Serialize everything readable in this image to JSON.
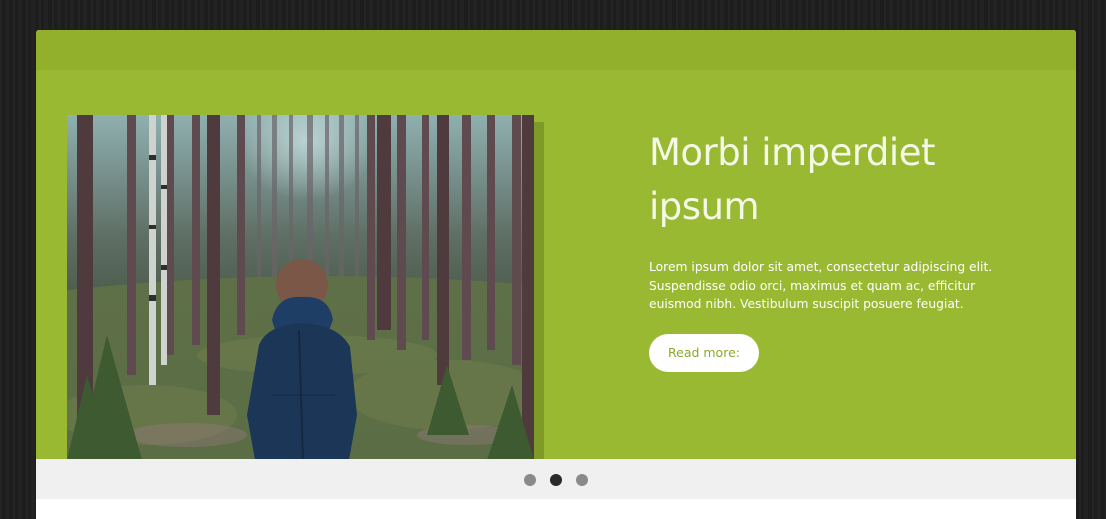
{
  "slider": {
    "title": "Morbi imperdiet ipsum",
    "text": "Lorem ipsum dolor sit amet, consectetur adipiscing elit. Suspendisse odio orci, maximus et quam ac, efficitur euismod nibh. Vestibulum suscipit posuere feugiat.",
    "button_label": "Read more:",
    "image_subject": "Person in a dark blue hooded coat standing in a pine forest, seen from behind",
    "pagination": {
      "count": 3,
      "active_index": 1
    }
  },
  "colors": {
    "accent_green": "#9ab932",
    "top_bar_green": "#93b02d",
    "button_text": "#8aa92a",
    "background_dark": "#1f1f1f",
    "dots_bar": "#f0f0f0",
    "dot_inactive": "#8a8a8a",
    "dot_active": "#2a2a2a"
  }
}
